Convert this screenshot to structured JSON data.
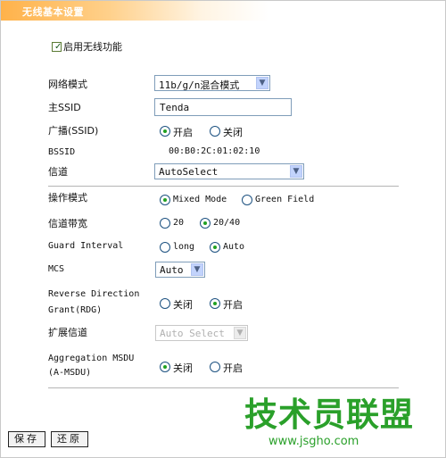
{
  "header": {
    "title": "无线基本设置"
  },
  "enable_wireless": {
    "label": "启用无线功能",
    "checked": true
  },
  "network_mode": {
    "label": "网络模式",
    "value": "11b/g/n混合模式"
  },
  "main_ssid": {
    "label": "主SSID",
    "value": "Tenda"
  },
  "broadcast_ssid": {
    "label": "广播(SSID)",
    "options": [
      {
        "label": "开启",
        "selected": true
      },
      {
        "label": "关闭",
        "selected": false
      }
    ]
  },
  "bssid": {
    "label": "BSSID",
    "value": "00:B0:2C:01:02:10"
  },
  "channel": {
    "label": "信道",
    "value": "AutoSelect"
  },
  "operation_mode": {
    "label": "操作模式",
    "options": [
      {
        "label": "Mixed Mode",
        "selected": true
      },
      {
        "label": "Green Field",
        "selected": false
      }
    ]
  },
  "channel_bandwidth": {
    "label": "信道带宽",
    "options": [
      {
        "label": "20",
        "selected": false
      },
      {
        "label": "20/40",
        "selected": true
      }
    ]
  },
  "guard_interval": {
    "label": "Guard Interval",
    "options": [
      {
        "label": "long",
        "selected": false
      },
      {
        "label": "Auto",
        "selected": true
      }
    ]
  },
  "mcs": {
    "label": "MCS",
    "value": "Auto"
  },
  "rdg": {
    "label_line1": "Reverse Direction",
    "label_line2": "Grant(RDG)",
    "options": [
      {
        "label": "关闭",
        "selected": false
      },
      {
        "label": "开启",
        "selected": true
      }
    ]
  },
  "extension_channel": {
    "label": "扩展信道",
    "value": "Auto Select",
    "disabled": true
  },
  "amsdu": {
    "label_line1": "Aggregation MSDU",
    "label_line2": "(A-MSDU)",
    "options": [
      {
        "label": "关闭",
        "selected": true
      },
      {
        "label": "开启",
        "selected": false
      }
    ]
  },
  "buttons": {
    "save": "保存",
    "restore": "还原"
  },
  "watermark": {
    "text": "技术员联盟",
    "url": "www.jsgho.com"
  },
  "colors": {
    "header_accent": "#ffb24a",
    "radio_dot": "#21a121",
    "watermark": "#2aa02a"
  }
}
